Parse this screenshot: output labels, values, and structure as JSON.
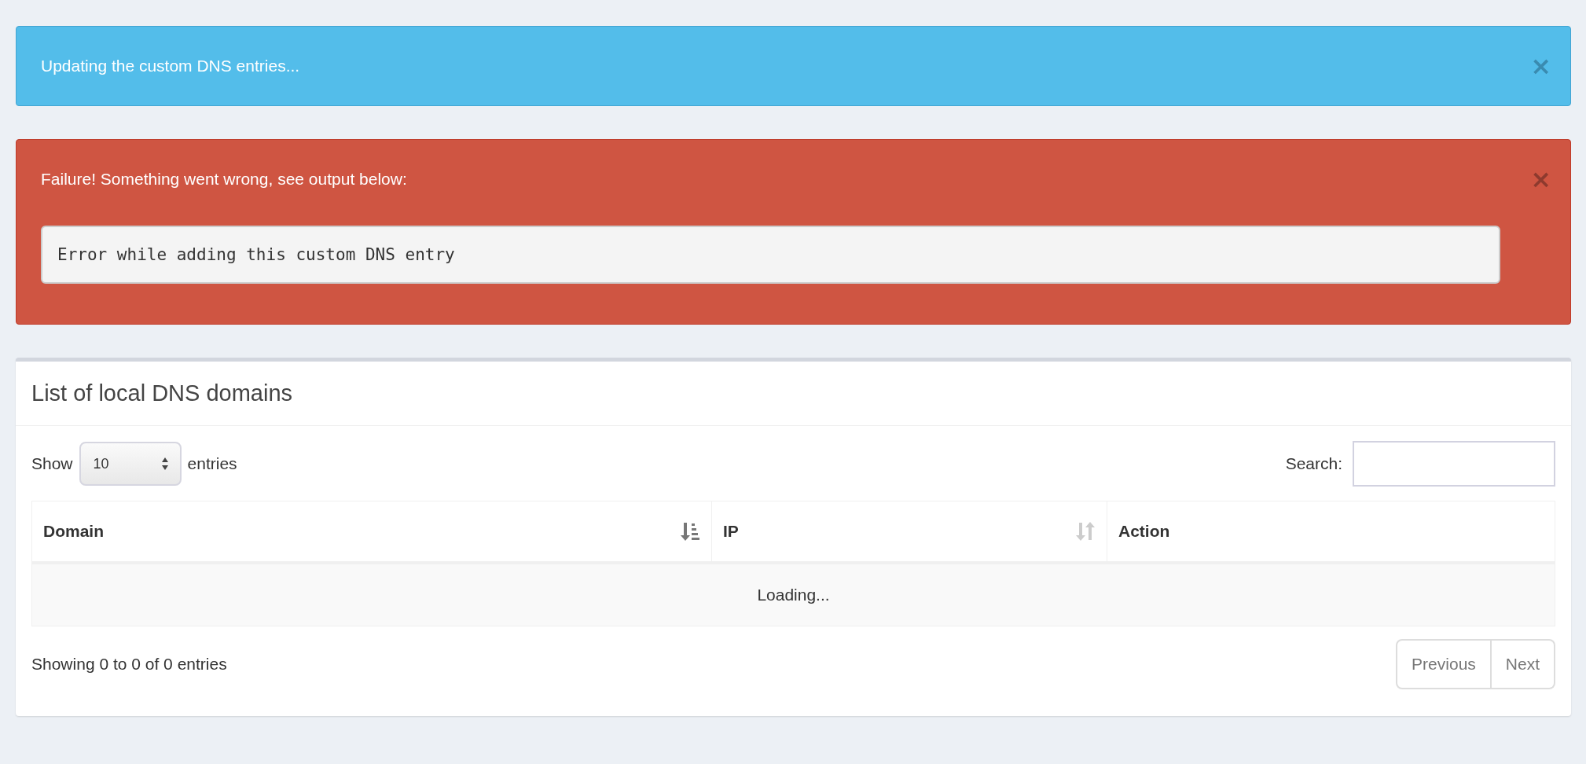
{
  "alerts": [
    {
      "kind": "info",
      "message": "Updating the custom DNS entries...",
      "close": "×"
    },
    {
      "kind": "danger",
      "message": "Failure! Something went wrong, see output below:",
      "output": "Error while adding this custom DNS entry",
      "close": "×"
    }
  ],
  "box": {
    "title": "List of local DNS domains",
    "length": {
      "label_before": "Show",
      "value": "10",
      "label_after": "entries"
    },
    "search": {
      "label": "Search:"
    },
    "table": {
      "columns": [
        {
          "label": "Domain",
          "sorted": true
        },
        {
          "label": "IP",
          "sorted": false
        },
        {
          "label": "Action"
        }
      ],
      "message": "Loading..."
    },
    "info": "Showing 0 to 0 of 0 entries",
    "pagination": [
      {
        "label": "Previous",
        "disabled": true
      },
      {
        "label": "Next",
        "disabled": true
      }
    ]
  }
}
